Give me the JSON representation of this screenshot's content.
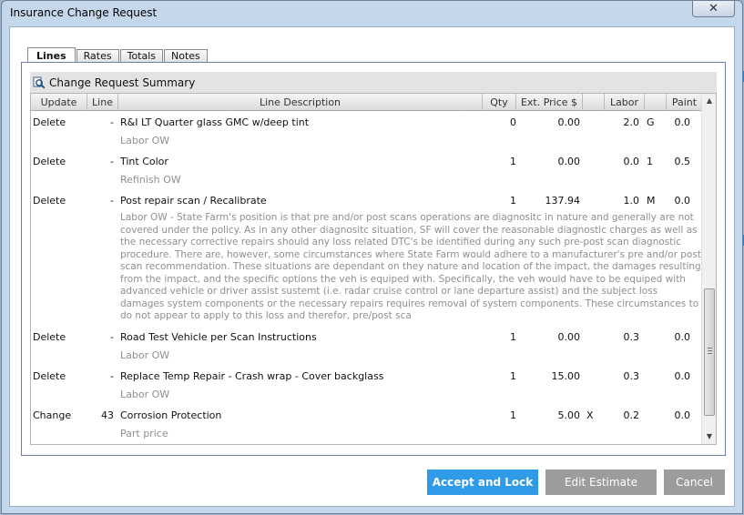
{
  "window": {
    "title": "Insurance Change Request",
    "close_glyph": "✕"
  },
  "tabs": [
    {
      "label": "Lines",
      "active": true
    },
    {
      "label": "Rates",
      "active": false
    },
    {
      "label": "Totals",
      "active": false
    },
    {
      "label": "Notes",
      "active": false
    }
  ],
  "panel": {
    "title": "Change Request Summary",
    "icon": "magnifier-icon"
  },
  "columns": {
    "update": "Update",
    "line": "Line",
    "description": "Line Description",
    "qty": "Qty",
    "ext_price": "Ext. Price $",
    "labor": "Labor",
    "paint": "Paint"
  },
  "rows": [
    {
      "update": "Delete",
      "line": "-",
      "description": "R&I LT Quarter glass GMC w/deep tint",
      "qty": "0",
      "price": "0.00",
      "labor": "2.0",
      "code": "G",
      "paint": "0.0",
      "sub": "Labor OW"
    },
    {
      "update": "Delete",
      "line": "-",
      "description": "Tint Color",
      "qty": "1",
      "price": "0.00",
      "labor": "0.0",
      "code": "1",
      "paint": "0.5",
      "sub": "Refinish OW"
    },
    {
      "update": "Delete",
      "line": "-",
      "description": "Post repair scan / Recalibrate",
      "qty": "1",
      "price": "137.94",
      "labor": "1.0",
      "code": "M",
      "paint": "0.0",
      "sub": "Labor OW - State Farm's position is that pre and/or post scans operations are diagnositc in nature and generally are not covered under the policy.  As in any other diagnositc situation, SF will cover the reasonable diagnostic charges as well as the necessary corrective repairs should any loss related DTC's be identified during any such pre-post scan diagnostic procedure.  There are, however, some circumstances where State Farm would adhere to a manufacturer's pre and/or post scan recommendation.  These situations are dependant on they nature and location of the impact, the damages resulting from the impact, and the specific options the veh is equiped with.  Specifically, the veh would have to be equiped with advanced vehicle or driver assist sustemt (i.e. radar cruise control or lane departure assist) and the subject loss damages system components or the necessary repairs requires removal of system components.  These circumstances to do not appear to apply to this loss and therefor, pre/post sca"
    },
    {
      "update": "Delete",
      "line": "-",
      "description": "Road Test Vehicle per Scan Instructions",
      "qty": "1",
      "price": "0.00",
      "labor": "0.3",
      "code": "",
      "paint": "0.0",
      "sub": "Labor OW"
    },
    {
      "update": "Delete",
      "line": "-",
      "description": "Replace Temp Repair - Crash wrap - Cover backglass",
      "qty": "1",
      "price": "15.00",
      "labor": "0.3",
      "code": "",
      "paint": "0.0",
      "sub": "Labor OW"
    },
    {
      "update": "Change",
      "line": "43",
      "description": "Corrosion Protection",
      "qty": "1",
      "price": "5.00",
      "price_flag": "X",
      "labor": "0.2",
      "code": "",
      "paint": "0.0",
      "sub": "Part price"
    }
  ],
  "buttons": {
    "accept": "Accept and Lock",
    "edit": "Edit Estimate",
    "cancel": "Cancel"
  },
  "colors": {
    "accent": "#2e9ae8",
    "secondary_button": "#9c9c9c",
    "sub_text": "#8f8f8f"
  }
}
